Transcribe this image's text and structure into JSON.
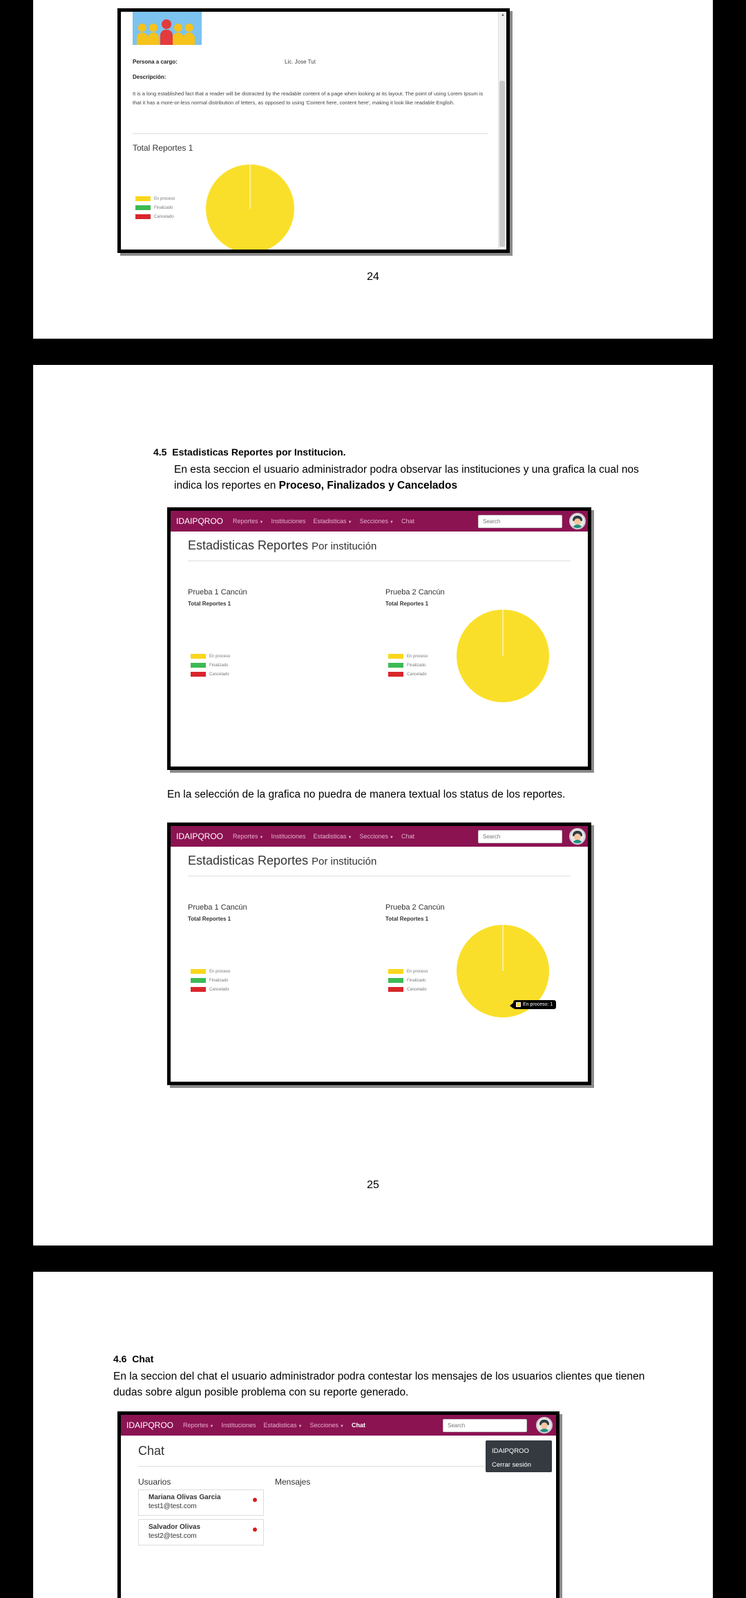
{
  "colors": {
    "navbar": "#8b1352",
    "en_proceso": "#f9d71c",
    "finalizado": "#3cba54",
    "cancelado": "#d9262c",
    "pie_yellow": "#fadf2a"
  },
  "page1": {
    "persona_label": "Persona a cargo:",
    "persona_value": "Lic. Jose Tut",
    "descripcion_label": "Descripción:",
    "descripcion_text": "It is a long established fact that a reader will be distracted by the readable content of a page when looking at its layout. The point of using Lorem Ipsum is that it has a more-or-less normal distribution of letters, as opposed to using 'Content here, content here', making it look like readable English.",
    "total_reportes": "Total Reportes 1",
    "page_number": "24"
  },
  "page2": {
    "heading_number": "4.5",
    "heading_title": "Estadisticas Reportes por Institucion.",
    "intro_text": "En esta seccion el usuario administrador podra observar las instituciones  y una grafica la cual nos indica los reportes en ",
    "intro_bold": "Proceso, Finalizados y Cancelados",
    "middle_text": "En la selección de la grafica no puedra de manera textual los status de los reportes.",
    "page_number": "25"
  },
  "page3": {
    "heading_number": "4.6",
    "heading_title": "Chat",
    "intro_text": "En la seccion del chat el usuario administrador podra contestar los mensajes de los usuarios clientes que tienen dudas sobre algun posible problema con su reporte generado."
  },
  "navbar": {
    "brand": "IDAIPQROO",
    "items": [
      "Reportes",
      "Instituciones",
      "Estadisticas",
      "Secciones",
      "Chat"
    ],
    "search_placeholder": "Search"
  },
  "stats": {
    "title": "Estadisticas Reportes",
    "subtitle": "Por institución",
    "institutions": [
      {
        "name": "Prueba 1 Cancún",
        "total": "Total Reportes 1"
      },
      {
        "name": "Prueba 2 Cancún",
        "total": "Total Reportes 1"
      }
    ],
    "tooltip": "En proceso: 1"
  },
  "legend": [
    "En proceso",
    "Finalizado",
    "Cancelado"
  ],
  "chat": {
    "title": "Chat",
    "usuarios_label": "Usuarios",
    "mensajes_label": "Mensajes",
    "users": [
      {
        "name": "Mariana Olivas Garcia",
        "email": "test1@test.com"
      },
      {
        "name": "Salvador Olivas",
        "email": "test2@test.com"
      }
    ],
    "dropdown": [
      "IDAIPQROO",
      "Cerrar sesión"
    ]
  },
  "chart_data": [
    {
      "type": "pie",
      "title": "Total Reportes 1",
      "categories": [
        "En proceso",
        "Finalizado",
        "Cancelado"
      ],
      "values": [
        1,
        0,
        0
      ]
    },
    {
      "type": "pie",
      "title": "Total Reportes 1",
      "categories": [
        "En proceso",
        "Finalizado",
        "Cancelado"
      ],
      "values": [
        0,
        0,
        0
      ]
    },
    {
      "type": "pie",
      "title": "Total Reportes 1",
      "categories": [
        "En proceso",
        "Finalizado",
        "Cancelado"
      ],
      "values": [
        1,
        0,
        0
      ]
    },
    {
      "type": "pie",
      "title": "Total Reportes 1",
      "categories": [
        "En proceso",
        "Finalizado",
        "Cancelado"
      ],
      "values": [
        0,
        0,
        0
      ]
    },
    {
      "type": "pie",
      "title": "Total Reportes 1",
      "categories": [
        "En proceso",
        "Finalizado",
        "Cancelado"
      ],
      "values": [
        1,
        0,
        0
      ]
    }
  ]
}
